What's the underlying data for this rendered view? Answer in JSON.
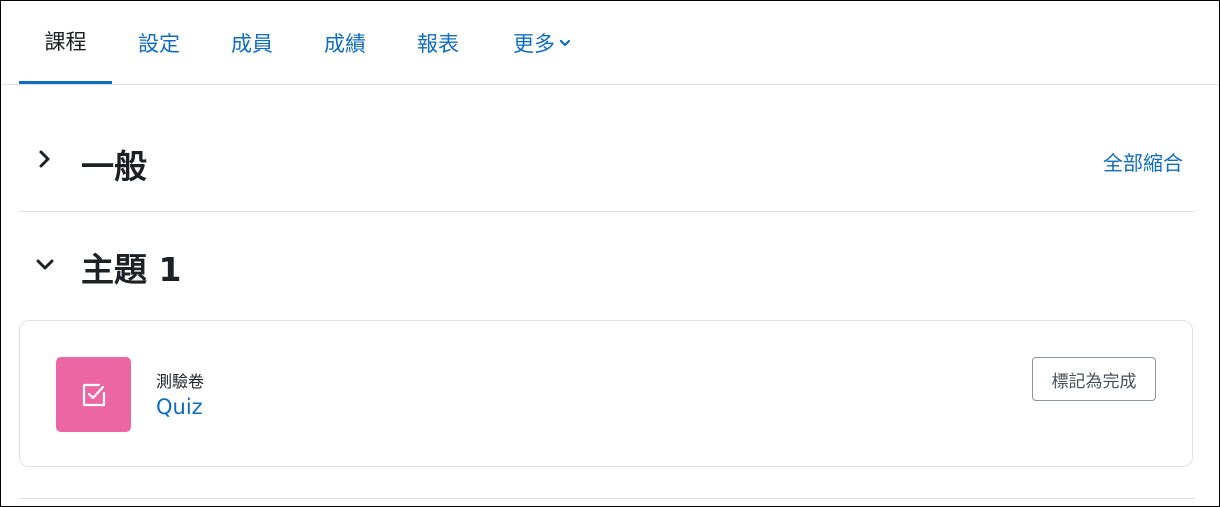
{
  "nav": {
    "tabs": [
      {
        "label": "課程",
        "active": true
      },
      {
        "label": "設定"
      },
      {
        "label": "成員"
      },
      {
        "label": "成績"
      },
      {
        "label": "報表"
      },
      {
        "label": "更多",
        "dropdown": true
      }
    ]
  },
  "sections": [
    {
      "title": "一般",
      "state": "collapsed",
      "toggle_icon": "chevron-right-icon"
    },
    {
      "title": "主題 1",
      "state": "expanded",
      "toggle_icon": "chevron-down-icon"
    }
  ],
  "collapse_all_label": "全部縮合",
  "activity": {
    "type_label": "測驗卷",
    "name": "Quiz",
    "icon": "quiz-checkbox-icon",
    "icon_color": "#eb66a2",
    "completion_button": "標記為完成"
  },
  "colors": {
    "link": "#0f6cbf",
    "text": "#1d2125",
    "border": "#dee2e6"
  }
}
